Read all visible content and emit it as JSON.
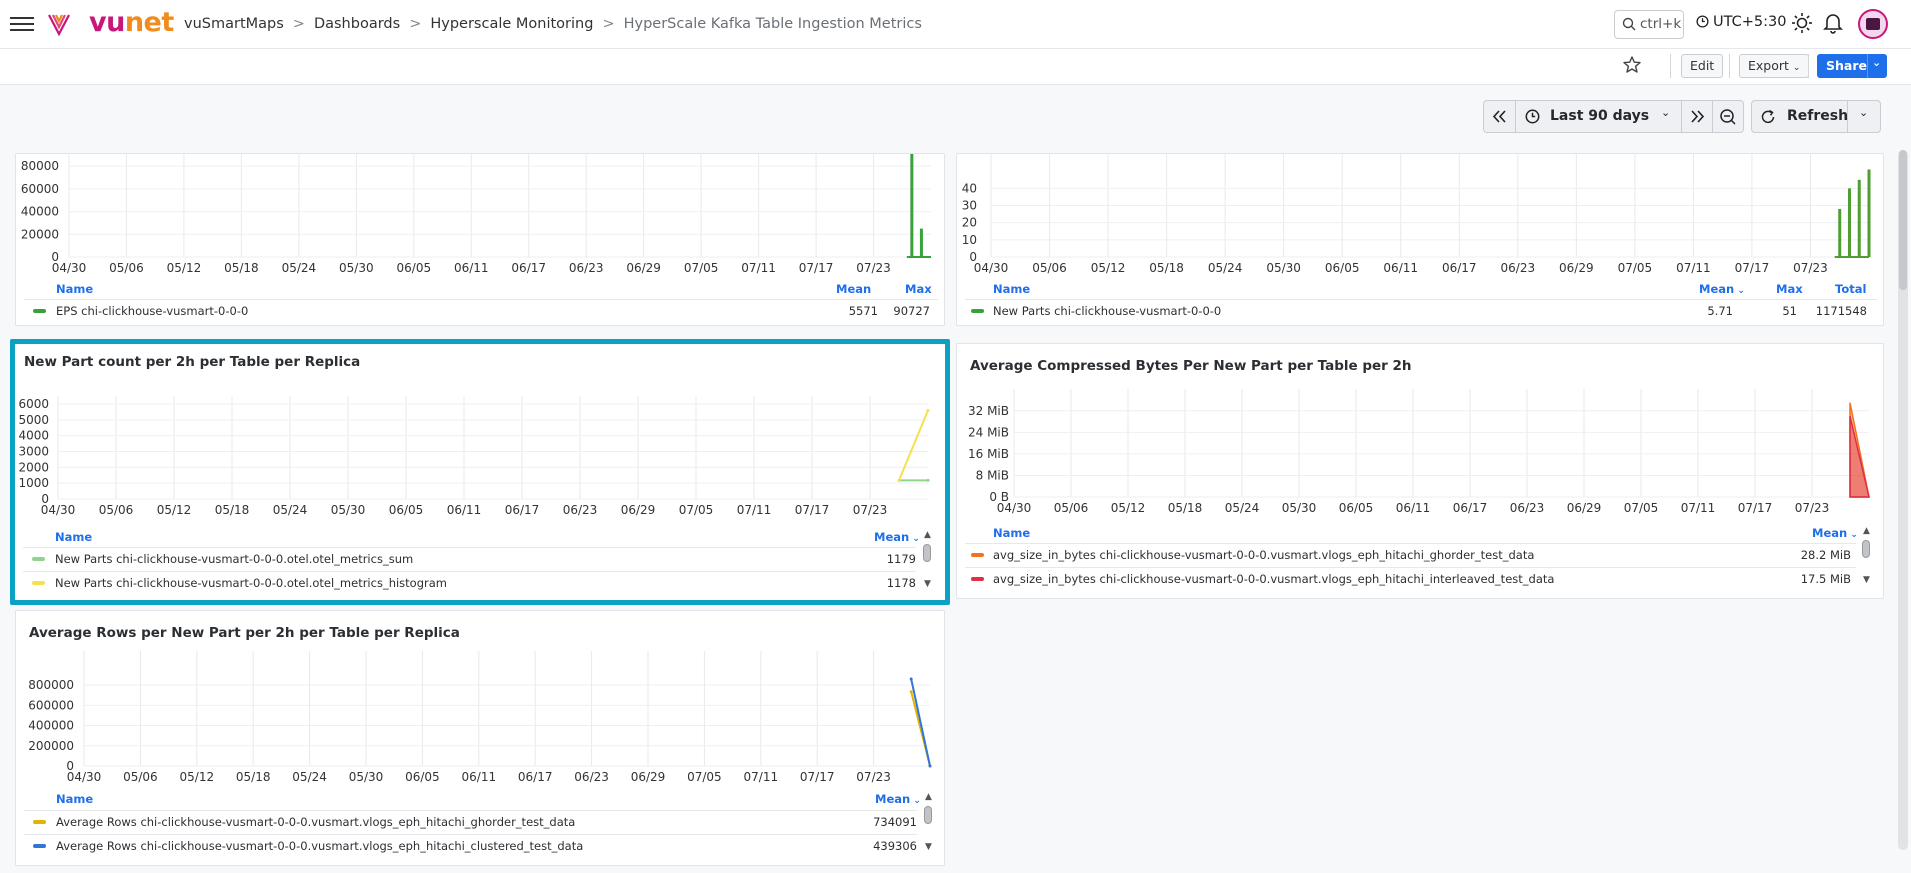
{
  "header": {
    "logo_text_vu": "vu",
    "logo_text_net": "net",
    "breadcrumb": [
      "vuSmartMaps",
      "Dashboards",
      "Hyperscale Monitoring",
      "HyperScale Kafka Table Ingestion Metrics"
    ],
    "search_placeholder": "ctrl+k",
    "timezone": "UTC+5:30",
    "icons": [
      "hamburger-icon",
      "search-icon",
      "clock-icon",
      "sun-icon",
      "bell-icon",
      "avatar"
    ]
  },
  "toolbar": {
    "edit_label": "Edit",
    "export_label": "Export",
    "share_label": "Share"
  },
  "time_controls": {
    "range_label": "Last 90 days",
    "refresh_label": "Refresh"
  },
  "x_ticks": [
    "04/30",
    "05/06",
    "05/12",
    "05/18",
    "05/24",
    "05/30",
    "06/05",
    "06/11",
    "06/17",
    "06/23",
    "06/29",
    "07/05",
    "07/11",
    "07/17",
    "07/23"
  ],
  "colors": {
    "accent": "#1f6feb",
    "selected_border": "#0aa1c2",
    "brand_magenta": "#c8177a",
    "brand_orange": "#f08b1d"
  },
  "panels": {
    "eps": {
      "title": "",
      "legend_name": "Name",
      "legend_cols": [
        "Mean",
        "Max"
      ],
      "rows": [
        {
          "name": "EPS chi-clickhouse-vusmart-0-0-0",
          "color": "#37a23a",
          "values": [
            "5571",
            "90727"
          ]
        }
      ]
    },
    "new_parts": {
      "title": "",
      "legend_name": "Name",
      "legend_cols": [
        "Mean",
        "Max",
        "Total"
      ],
      "rows": [
        {
          "name": "New Parts chi-clickhouse-vusmart-0-0-0",
          "color": "#37a23a",
          "values": [
            "5.71",
            "51",
            "1171548"
          ]
        }
      ]
    },
    "part_count": {
      "title": "New Part count per 2h per Table per Replica",
      "legend_name": "Name",
      "legend_cols": [
        "Mean"
      ],
      "rows": [
        {
          "name": "New Parts chi-clickhouse-vusmart-0-0-0.otel.otel_metrics_sum",
          "color": "#8fd48a",
          "values": [
            "1179"
          ]
        },
        {
          "name": "New Parts chi-clickhouse-vusmart-0-0-0.otel.otel_metrics_histogram",
          "color": "#f4e24c",
          "values": [
            "1178"
          ]
        }
      ]
    },
    "compressed": {
      "title": "Average Compressed Bytes Per New Part per Table per 2h",
      "legend_name": "Name",
      "legend_cols": [
        "Mean"
      ],
      "rows": [
        {
          "name": "avg_size_in_bytes chi-clickhouse-vusmart-0-0-0.vusmart.vlogs_eph_hitachi_ghorder_test_data",
          "color": "#f2731c",
          "values": [
            "28.2 MiB"
          ]
        },
        {
          "name": "avg_size_in_bytes chi-clickhouse-vusmart-0-0-0.vusmart.vlogs_eph_hitachi_interleaved_test_data",
          "color": "#e02f44",
          "values": [
            "17.5 MiB"
          ]
        }
      ]
    },
    "avg_rows": {
      "title": "Average Rows per New Part per 2h per Table per Replica",
      "legend_name": "Name",
      "legend_cols": [
        "Mean"
      ],
      "rows": [
        {
          "name": "Average Rows chi-clickhouse-vusmart-0-0-0.vusmart.vlogs_eph_hitachi_ghorder_test_data",
          "color": "#e0b400",
          "values": [
            "734091"
          ]
        },
        {
          "name": "Average Rows chi-clickhouse-vusmart-0-0-0.vusmart.vlogs_eph_hitachi_clustered_test_data",
          "color": "#3274d9",
          "values": [
            "439306"
          ]
        }
      ]
    }
  },
  "chart_data": [
    {
      "type": "bar",
      "title": "",
      "y_ticks": [
        "80000",
        "60000",
        "40000",
        "20000",
        "0"
      ],
      "ylim": [
        0,
        90727
      ],
      "series": [
        {
          "name": "EPS chi-clickhouse-vusmart-0-0-0",
          "color": "#37a23a",
          "x": [
            "07/27",
            "07/28"
          ],
          "values": [
            90727,
            25000
          ]
        }
      ]
    },
    {
      "type": "bar",
      "title": "",
      "y_ticks": [
        "40",
        "30",
        "20",
        "10",
        "0"
      ],
      "ylim": [
        0,
        51
      ],
      "series": [
        {
          "name": "New Parts chi-clickhouse-vusmart-0-0-0",
          "color": "#4f9e32",
          "x": [
            "07/26",
            "07/27",
            "07/28",
            "07/29"
          ],
          "values": [
            28,
            40,
            45,
            51
          ]
        }
      ]
    },
    {
      "type": "line",
      "title": "New Part count per 2h per Table per Replica",
      "y_ticks": [
        "6000",
        "5000",
        "4000",
        "3000",
        "2000",
        "1000",
        "0"
      ],
      "ylim": [
        0,
        6000
      ],
      "series": [
        {
          "name": "New Parts chi-clickhouse-vusmart-0-0-0.otel.otel_metrics_sum",
          "color": "#8fd48a",
          "x": [
            "07/26",
            "07/29"
          ],
          "values": [
            1179,
            1179
          ]
        },
        {
          "name": "New Parts chi-clickhouse-vusmart-0-0-0.otel.otel_metrics_histogram",
          "color": "#f4e24c",
          "x": [
            "07/26",
            "07/29"
          ],
          "values": [
            1178,
            5600
          ]
        }
      ]
    },
    {
      "type": "area",
      "title": "Average Compressed Bytes Per New Part per Table per 2h",
      "y_ticks": [
        "32 MiB",
        "24 MiB",
        "16 MiB",
        "8 MiB",
        "0 B"
      ],
      "ylim": [
        0,
        36
      ],
      "series": [
        {
          "name": "avg_size_in_bytes chi-clickhouse-vusmart-0-0-0.vusmart.vlogs_eph_hitachi_ghorder_test_data",
          "color": "#f2731c",
          "x": [
            "07/27",
            "07/29"
          ],
          "values": [
            35,
            0
          ]
        },
        {
          "name": "avg_size_in_bytes chi-clickhouse-vusmart-0-0-0.vusmart.vlogs_eph_hitachi_interleaved_test_data",
          "color": "#e02f44",
          "x": [
            "07/27",
            "07/29"
          ],
          "values": [
            30,
            0
          ]
        }
      ]
    },
    {
      "type": "line",
      "title": "Average Rows per New Part per 2h per Table per Replica",
      "y_ticks": [
        "800000",
        "600000",
        "400000",
        "200000",
        "0"
      ],
      "ylim": [
        0,
        900000
      ],
      "series": [
        {
          "name": "Average Rows chi-clickhouse-vusmart-0-0-0.vusmart.vlogs_eph_hitachi_ghorder_test_data",
          "color": "#e0b400",
          "x": [
            "07/27",
            "07/29"
          ],
          "values": [
            734091,
            0
          ]
        },
        {
          "name": "Average Rows chi-clickhouse-vusmart-0-0-0.vusmart.vlogs_eph_hitachi_clustered_test_data",
          "color": "#3274d9",
          "x": [
            "07/27",
            "07/29"
          ],
          "values": [
            860000,
            0
          ]
        }
      ]
    }
  ]
}
